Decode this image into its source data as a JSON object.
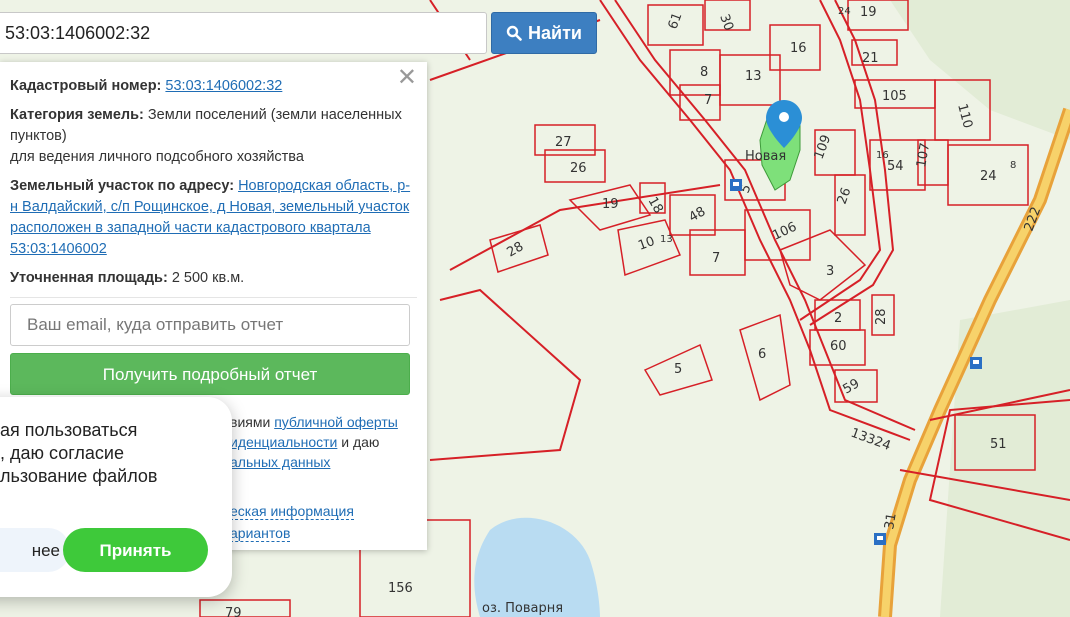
{
  "search": {
    "value": "53:03:1406002:32",
    "button_label": "Найти"
  },
  "panel": {
    "cadastral_label": "Кадастровый номер:",
    "cadastral_value": "53:03:1406002:32",
    "category_label": "Категория земель:",
    "category_value": "Земли поселений (земли населенных пунктов)",
    "category_purpose": "для ведения личного подсобного хозяйства",
    "address_label": "Земельный участок по адресу:",
    "address_value": "Новгородская область, р-н Валдайский, с/п Рощинское, д Новая, земельный участок расположен в западной части кадастрового квартала 53:03:1406002",
    "area_label": "Уточненная площадь:",
    "area_value": "2 500 кв.м.",
    "email_placeholder": "Ваш email, куда отправить отчет",
    "report_button": "Получить подробный отчет",
    "terms_prefix": "виями",
    "terms_link1": "публичной оферты",
    "terms_link2": "иденциальности",
    "terms_mid": "и даю",
    "terms_link3": "альных данных",
    "extra_link1": "еская информация",
    "extra_link2": "ариантов"
  },
  "cookie": {
    "line1": "ая пользоваться",
    "line2": ", даю согласие",
    "line3": "льзование файлов",
    "more_button": "нее",
    "accept_button": "Принять"
  },
  "map": {
    "village_label": "Новая",
    "lake_label": "оз. Поварня",
    "road_number_1": "222",
    "road_number_2": "31",
    "road_label": "13324",
    "plots": [
      "19",
      "61",
      "30",
      "24",
      "21",
      "105",
      "110",
      "8",
      "13",
      "16",
      "7",
      "27",
      "26",
      "109",
      "16",
      "54",
      "107",
      "24",
      "8",
      "5",
      "19",
      "18",
      "48",
      "26",
      "106",
      "10",
      "13",
      "28",
      "7",
      "3",
      "2",
      "28",
      "60",
      "6",
      "5",
      "59",
      "51",
      "156",
      "79"
    ],
    "colors": {
      "background": "#eef3e6",
      "boundary": "#d62027",
      "road_outer": "#e8a23a",
      "road_inner": "#f7d26a",
      "lake": "#b9dcf2",
      "parcel_fill": "#7ee07a",
      "pin": "#2b8fd6"
    }
  }
}
